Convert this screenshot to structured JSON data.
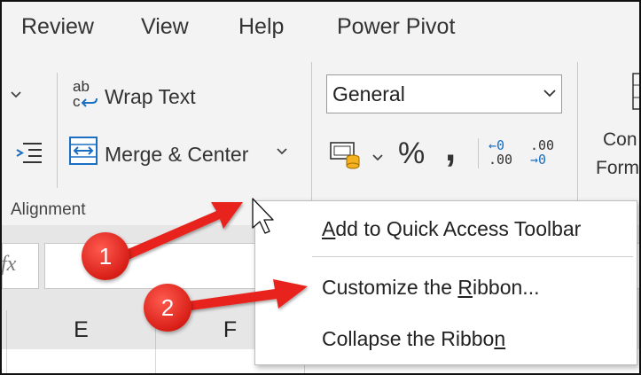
{
  "menu_tabs": [
    "Review",
    "View",
    "Help",
    "Power Pivot"
  ],
  "ribbon": {
    "wrap_text": "Wrap Text",
    "wrap_icon_text": [
      "ab",
      "c"
    ],
    "merge_center": "Merge & Center",
    "alignment_group": "Alignment",
    "number_format": "General",
    "percent": "%",
    "comma": ",",
    "increase_decimal": [
      "←0",
      ".00"
    ],
    "decrease_decimal": [
      ".00",
      "→0"
    ],
    "conditional_partial": [
      "Con",
      "Form"
    ]
  },
  "formula_bar": {
    "fx": "fx",
    "value": ""
  },
  "columns": [
    "E",
    "F"
  ],
  "context_menu": {
    "items": [
      {
        "pre": "",
        "u": "A",
        "post": "dd to Quick Access Toolbar"
      },
      {
        "pre": "Customize the ",
        "u": "R",
        "post": "ibbon..."
      },
      {
        "pre": "Collapse the Ribbo",
        "u": "n",
        "post": ""
      }
    ]
  },
  "annotations": {
    "badge1": "1",
    "badge2": "2"
  },
  "colors": {
    "ribbon_bg": "#f3f3f3",
    "icon_blue": "#1b6fc2",
    "arrow_red": "#e8221a",
    "badge_red": "#d81f17"
  }
}
